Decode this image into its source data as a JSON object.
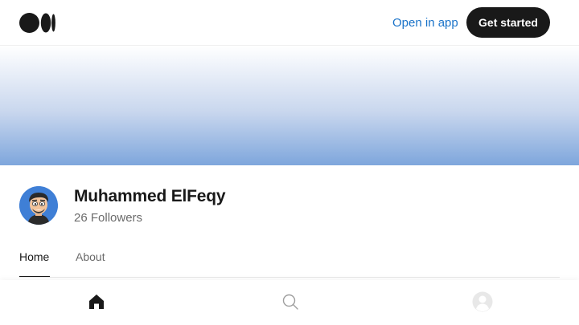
{
  "header": {
    "logo_icon": "medium-logo-icon",
    "open_in_app_label": "Open in app",
    "get_started_label": "Get started"
  },
  "banner": {
    "gradient_colors": [
      "#ffffff",
      "#c9d7ee",
      "#7ea6dc"
    ]
  },
  "profile": {
    "name": "Muhammed ElFeqy",
    "followers": "26 Followers",
    "avatar_icon": "cartoon-avatar"
  },
  "tabs": [
    {
      "label": "Home",
      "active": true
    },
    {
      "label": "About",
      "active": false
    }
  ],
  "bottom_nav": [
    {
      "icon": "home-icon",
      "active": true
    },
    {
      "icon": "search-icon",
      "active": false
    },
    {
      "icon": "user-profile-icon",
      "active": false
    }
  ],
  "colors": {
    "accent_link": "#1a73c9",
    "button_dark": "#191919",
    "muted_text": "#6b6b6b"
  }
}
